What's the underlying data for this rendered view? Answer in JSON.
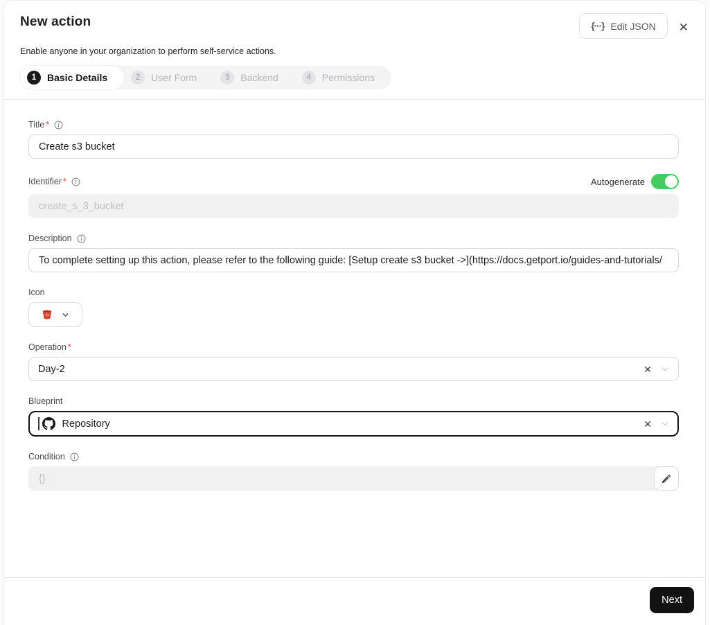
{
  "header": {
    "title": "New action",
    "subtitle": "Enable anyone in your organization to perform self-service actions.",
    "edit_json": {
      "label": "Edit JSON",
      "icon": "{···}"
    },
    "close_icon": "✕"
  },
  "stepper": {
    "active_step": "Basic Details",
    "steps": [
      {
        "number": "1",
        "label": "Basic Details"
      },
      {
        "number": "2",
        "label": "User Form"
      },
      {
        "number": "3",
        "label": "Backend"
      },
      {
        "number": "4",
        "label": "Permissions"
      }
    ]
  },
  "form": {
    "title": {
      "label": "Title",
      "required_mark": "*",
      "value": "Create s3 bucket"
    },
    "identifier": {
      "label": "Identifier",
      "required_mark": "*",
      "value": "create_s_3_bucket",
      "autogenerate_label": "Autogenerate",
      "autogenerate_enabled": true
    },
    "description": {
      "label": "Description",
      "value": "To complete setting up this action, please refer to the following guide: [Setup create s3 bucket ->](https://docs.getport.io/guides-and-tutorials/"
    },
    "icon": {
      "label": "Icon",
      "selected": "AWS S3"
    },
    "operation": {
      "label": "Operation",
      "required_mark": "*",
      "value": "Day-2",
      "clear_icon": "✕"
    },
    "blueprint": {
      "label": "Blueprint",
      "value": "Repository",
      "blueprint_icon": "github",
      "clear_icon": "✕",
      "focused": true
    },
    "condition": {
      "label": "Condition",
      "placeholder": "{}"
    }
  },
  "footer": {
    "next_label": "Next"
  },
  "colors": {
    "toggle_green": "#45cb60",
    "required_red": "#f1402a",
    "primary_black": "#121212",
    "s3_red": "#d8432f"
  }
}
